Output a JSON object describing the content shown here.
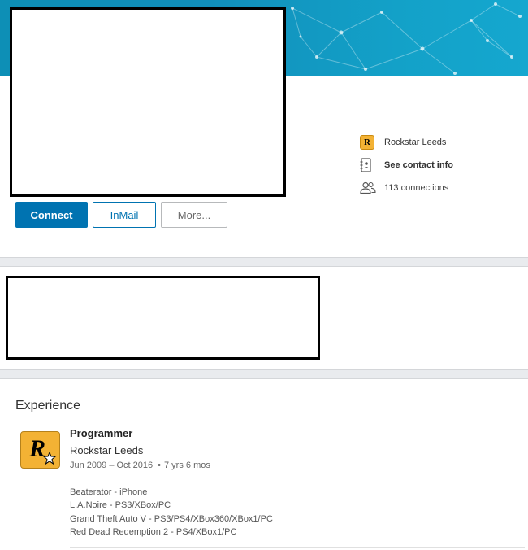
{
  "profile": {
    "actions": {
      "connect_label": "Connect",
      "inmail_label": "InMail",
      "more_label": "More..."
    },
    "info": {
      "company": "Rockstar Leeds",
      "company_icon": "rockstar-logo-icon",
      "contact_label": "See contact info",
      "contact_icon": "contact-book-icon",
      "connections_label": "113 connections",
      "connections_icon": "people-icon"
    }
  },
  "experience": {
    "heading": "Experience",
    "items": [
      {
        "title": "Programmer",
        "company": "Rockstar Leeds",
        "date_range": "Jun 2009 – Oct 2016",
        "separator": "•",
        "duration": "7 yrs 6 mos",
        "description_lines": [
          "Beaterator - iPhone",
          "L.A.Noire - PS3/XBox/PC",
          "Grand Theft Auto V - PS3/PS4/XBox360/XBox1/PC",
          "Red Dead Redemption 2 - PS4/XBox1/PC"
        ]
      }
    ]
  },
  "colors": {
    "primary": "#0073b1",
    "banner": "#118fbb",
    "rockstar_yellow": "#f3b234"
  }
}
